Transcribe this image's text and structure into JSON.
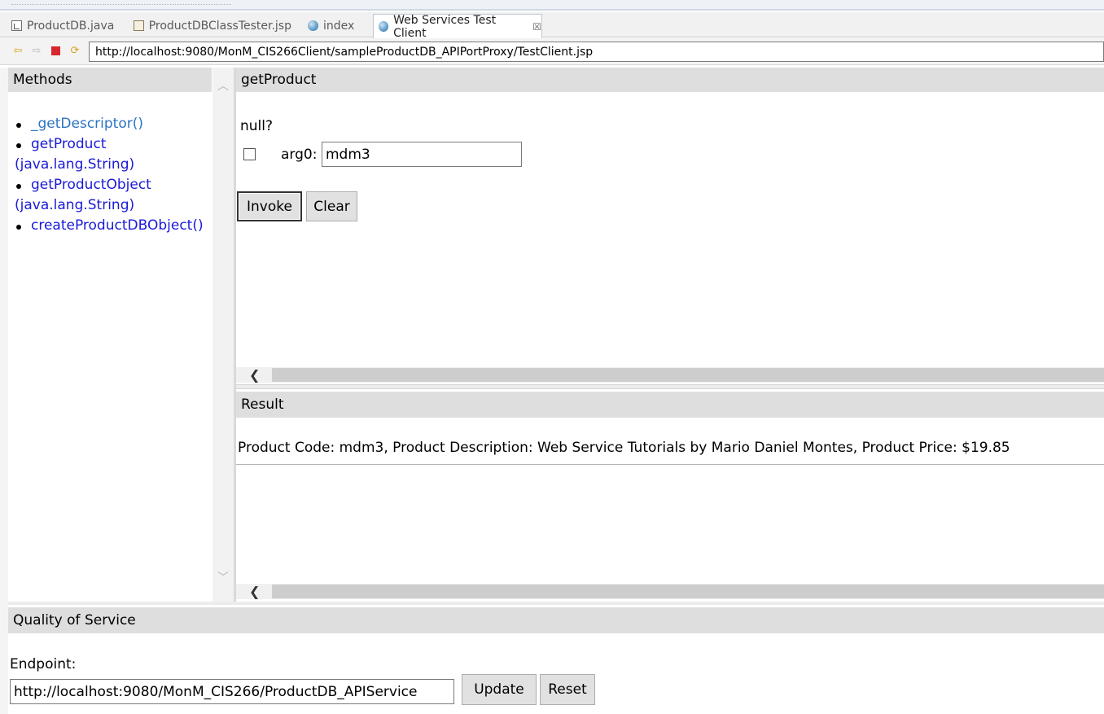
{
  "tabs": [
    {
      "label": "ProductDB.java",
      "icon": "java-file-icon"
    },
    {
      "label": "ProductDBClassTester.jsp",
      "icon": "jsp-file-icon"
    },
    {
      "label": "index",
      "icon": "globe-icon"
    },
    {
      "label": "Web Services Test Client",
      "icon": "globe-icon",
      "active": true,
      "close": "☒"
    }
  ],
  "address": {
    "url": "http://localhost:9080/MonM_CIS266Client/sampleProductDB_APIPortProxy/TestClient.jsp"
  },
  "methods": {
    "title": "Methods",
    "items": [
      {
        "name": "_getDescriptor()",
        "param": ""
      },
      {
        "name": "getProduct",
        "param": "(java.lang.String)"
      },
      {
        "name": "getProductObject",
        "param": "(java.lang.String)"
      },
      {
        "name": "createProductDBObject()",
        "param": ""
      }
    ]
  },
  "operation": {
    "title": "getProduct",
    "null_label": "null?",
    "arg_label": "arg0:",
    "arg_value": "mdm3",
    "invoke_label": "Invoke",
    "clear_label": "Clear"
  },
  "result": {
    "title": "Result",
    "text": "Product Code: mdm3, Product Description: Web Service Tutorials by Mario Daniel Montes, Product Price: $19.85"
  },
  "qos": {
    "title": "Quality of Service",
    "endpoint_label": "Endpoint:",
    "endpoint_value": "http://localhost:9080/MonM_CIS266/ProductDB_APIService",
    "update_label": "Update",
    "reset_label": "Reset"
  },
  "colors": {
    "link": "#1a1ad8",
    "panel_header": "#dedede",
    "stop": "#d7262d"
  }
}
